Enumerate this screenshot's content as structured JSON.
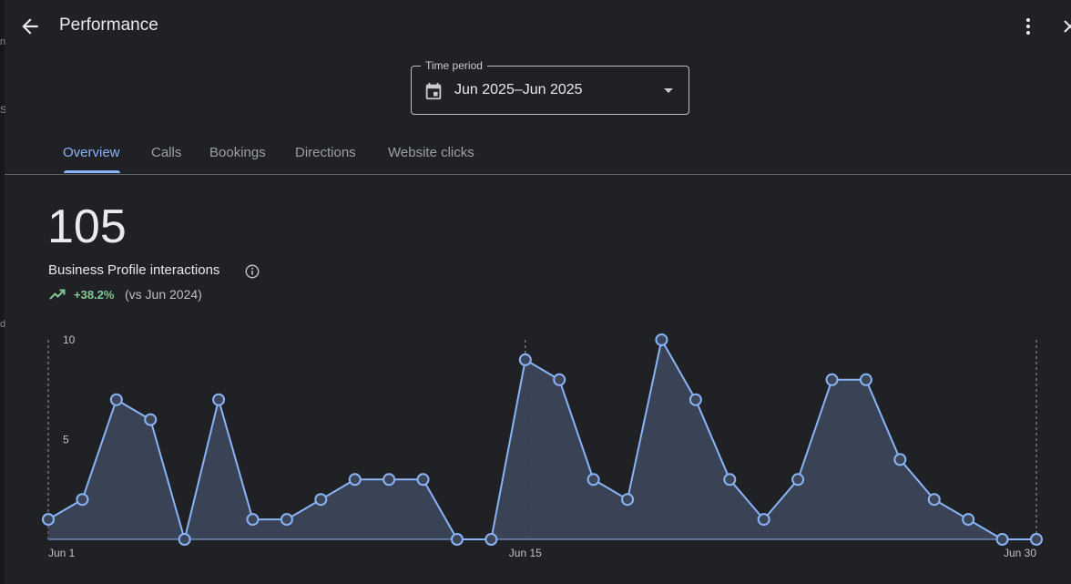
{
  "header": {
    "title": "Performance",
    "icons": {
      "back": "arrow-back-icon",
      "more": "more-vert-icon",
      "close": "close-icon"
    }
  },
  "time_period": {
    "label": "Time period",
    "value": "Jun 2025–Jun 2025",
    "icon": "calendar-icon"
  },
  "tabs": [
    {
      "label": "Overview",
      "active": true
    },
    {
      "label": "Calls",
      "active": false
    },
    {
      "label": "Bookings",
      "active": false
    },
    {
      "label": "Directions",
      "active": false
    },
    {
      "label": "Website clicks",
      "active": false
    }
  ],
  "metric": {
    "value": "105",
    "label": "Business Profile interactions",
    "change": "+38.2%",
    "compare": "(vs Jun 2024)"
  },
  "colors": {
    "background": "#202124",
    "accent": "#8ab4f8",
    "positive": "#81c995",
    "area_fill": "#3c4658"
  },
  "chart_data": {
    "type": "area",
    "title": "",
    "xlabel": "",
    "ylabel": "",
    "x": [
      1,
      2,
      3,
      4,
      5,
      6,
      7,
      8,
      9,
      10,
      11,
      12,
      13,
      14,
      15,
      16,
      17,
      18,
      19,
      20,
      21,
      22,
      23,
      24,
      25,
      26,
      27,
      28,
      29,
      30
    ],
    "x_tick_labels": [
      {
        "x": 1,
        "label": "Jun 1"
      },
      {
        "x": 15,
        "label": "Jun 15"
      },
      {
        "x": 30,
        "label": "Jun 30"
      }
    ],
    "y_ticks": [
      5,
      10
    ],
    "ylim": [
      0,
      10
    ],
    "series": [
      {
        "values": [
          1,
          2,
          7,
          6,
          0,
          7,
          1,
          1,
          2,
          3,
          3,
          3,
          0,
          0,
          9,
          8,
          3,
          2,
          10,
          7,
          3,
          1,
          3,
          8,
          8,
          4,
          2,
          1,
          0,
          0
        ]
      }
    ],
    "grid": false
  }
}
